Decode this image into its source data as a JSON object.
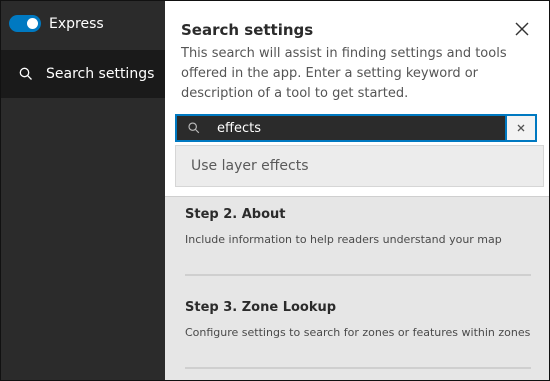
{
  "sidebar": {
    "express_label": "Express",
    "express_on": true,
    "nav_items": [
      {
        "label": "Search settings",
        "icon": "search-icon"
      }
    ]
  },
  "popup": {
    "title": "Search settings",
    "description": "This search will assist in finding settings and tools offered in the app. Enter a setting keyword or description of a tool to get started.",
    "search_value": "effects",
    "suggestions": [
      "Use layer effects"
    ]
  },
  "steps": [
    {
      "title": "Step 2. About",
      "description": "Include information to help readers understand your map"
    },
    {
      "title": "Step 3. Zone Lookup",
      "description": "Configure settings to search for zones or features within zones"
    }
  ],
  "colors": {
    "accent": "#0079c1",
    "sidebar_bg": "#2b2b2b",
    "nav_active_bg": "#1a1a1a",
    "content_bg": "#e6e6e6"
  }
}
